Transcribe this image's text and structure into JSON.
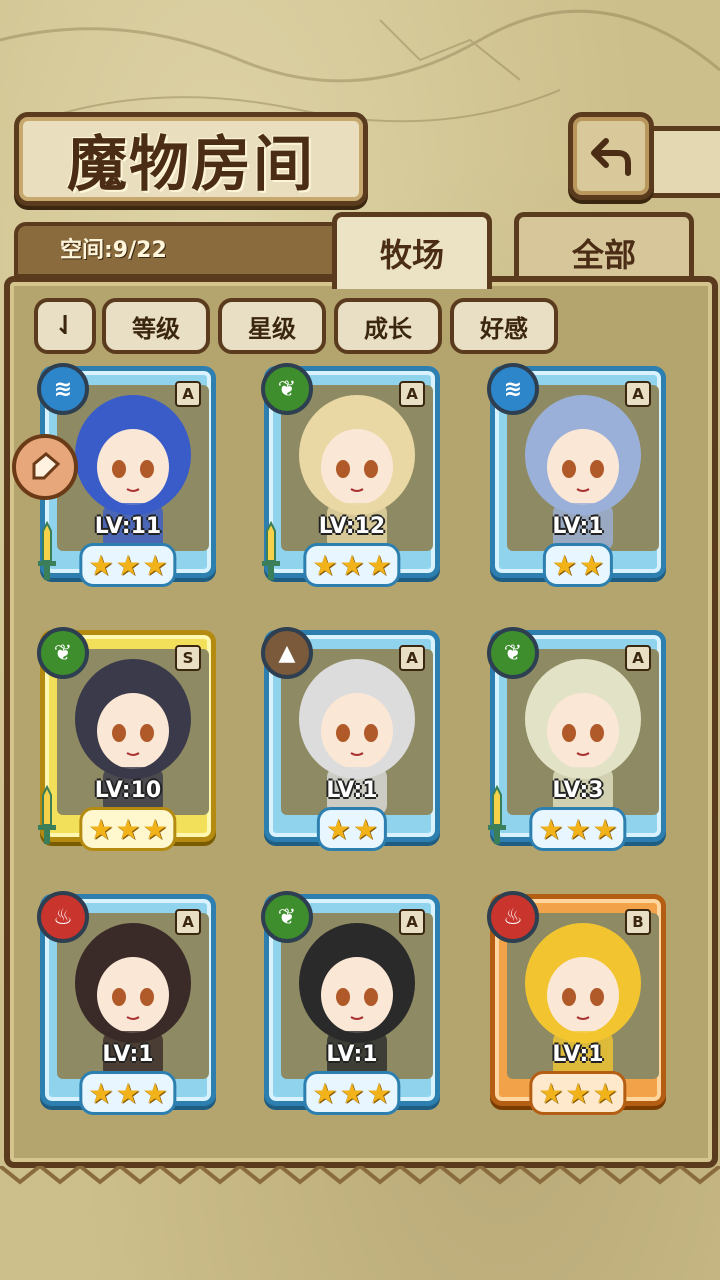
{
  "title": "魔物房间",
  "capacity": "空间:9/22",
  "tabs": [
    {
      "label": "牧场",
      "active": true
    },
    {
      "label": "全部",
      "active": false
    }
  ],
  "sort_label": "⇃",
  "filters": [
    "等级",
    "星级",
    "成长",
    "好感"
  ],
  "cards": [
    {
      "element": "water",
      "rank": "A",
      "level": "LV:11",
      "stars": 3,
      "frame": "blue",
      "sword": true,
      "hair": "#3a5cc8"
    },
    {
      "element": "leaf",
      "rank": "A",
      "level": "LV:12",
      "stars": 3,
      "frame": "blue",
      "sword": true,
      "hair": "#e9d7a4"
    },
    {
      "element": "water",
      "rank": "A",
      "level": "LV:1",
      "stars": 2,
      "frame": "blue",
      "sword": false,
      "hair": "#9bb0d8"
    },
    {
      "element": "leaf",
      "rank": "S",
      "level": "LV:10",
      "stars": 3,
      "frame": "gold",
      "sword": true,
      "hair": "#3b3a4a"
    },
    {
      "element": "earth",
      "rank": "A",
      "level": "LV:1",
      "stars": 2,
      "frame": "blue",
      "sword": false,
      "hair": "#dcdcdc"
    },
    {
      "element": "leaf",
      "rank": "A",
      "level": "LV:3",
      "stars": 3,
      "frame": "blue",
      "sword": true,
      "hair": "#e2e2c6"
    },
    {
      "element": "fire",
      "rank": "A",
      "level": "LV:1",
      "stars": 3,
      "frame": "blue",
      "sword": false,
      "hair": "#3a2a28"
    },
    {
      "element": "leaf",
      "rank": "A",
      "level": "LV:1",
      "stars": 3,
      "frame": "blue",
      "sword": false,
      "hair": "#2a2a2a"
    },
    {
      "element": "fire",
      "rank": "B",
      "level": "LV:1",
      "stars": 3,
      "frame": "orange",
      "sword": false,
      "hair": "#f2c530"
    }
  ]
}
